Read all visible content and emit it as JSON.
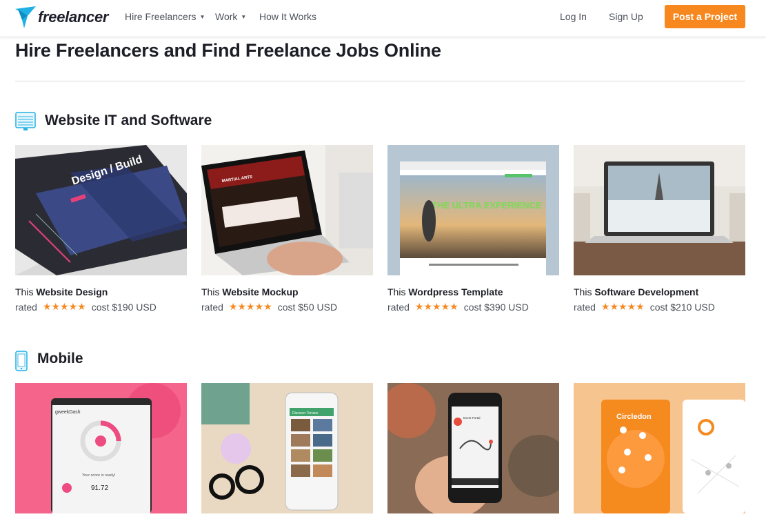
{
  "header": {
    "logo_text": "freelancer",
    "nav": [
      {
        "label": "Hire Freelancers",
        "has_caret": true
      },
      {
        "label": "Work",
        "has_caret": true
      },
      {
        "label": "How It Works",
        "has_caret": false
      }
    ],
    "login": "Log In",
    "signup": "Sign Up",
    "post_project": "Post a Project",
    "accent_color": "#f7881f",
    "logo_color": "#1fb1e6"
  },
  "page_title": "Hire Freelancers and Find Freelance Jobs Online",
  "sections": [
    {
      "title": "Website IT and Software",
      "icon": "monitor-icon",
      "cards": [
        {
          "prefix": "This",
          "name": "Website Design",
          "rated": "rated",
          "stars": "★★★★★",
          "cost": "cost $190 USD",
          "thumb_text": "Design / Build"
        },
        {
          "prefix": "This",
          "name": "Website Mockup",
          "rated": "rated",
          "stars": "★★★★★",
          "cost": "cost $50 USD",
          "thumb_text": "MARTIAL ARTS"
        },
        {
          "prefix": "This",
          "name": "Wordpress Template",
          "rated": "rated",
          "stars": "★★★★★",
          "cost": "cost $390 USD",
          "thumb_text": "THE ULTRA EXPERIENCE"
        },
        {
          "prefix": "This",
          "name": "Software Development",
          "rated": "rated",
          "stars": "★★★★★",
          "cost": "cost $210 USD",
          "thumb_text": ""
        }
      ]
    },
    {
      "title": "Mobile",
      "icon": "smartphone-icon",
      "cards": [
        {
          "thumb_text": "gweekDash",
          "score_label": "Your score is ready!",
          "score": "91.72"
        },
        {
          "thumb_text": "Discover Terrace"
        },
        {
          "thumb_text": "Event Portal"
        },
        {
          "thumb_text": "Circledon"
        }
      ]
    }
  ]
}
